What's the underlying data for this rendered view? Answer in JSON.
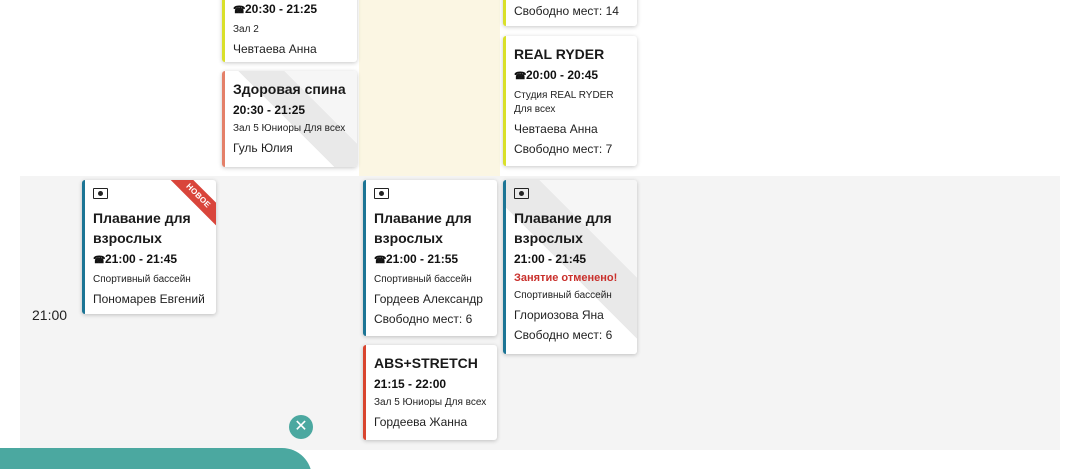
{
  "time_slot": "21:00",
  "cards_top": [
    {
      "time": "20:30 - 21:25",
      "hall": "Зал 2",
      "coach": "Чевтаева Анна"
    },
    {
      "title": "Здоровая спина",
      "time": "20:30 - 21:25",
      "hall": "Зал 5 Юниоры Для всех",
      "coach": "Гуль Юлия"
    },
    {
      "free": "Свободно мест: 14"
    },
    {
      "title": "REAL RYDER",
      "time": "20:00 - 20:45",
      "hall": "Студия REAL RYDER Для всех",
      "coach": "Чевтаева Анна",
      "free": "Свободно мест: 7"
    }
  ],
  "cards_2100": [
    {
      "title": "Плавание для взрослых",
      "time": "21:00 - 21:45",
      "hall": "Спортивный бассейн",
      "coach": "Пономарев Евгений",
      "ribbon": "НОВОЕ"
    },
    {
      "title": "Плавание для взрослых",
      "time": "21:00 - 21:55",
      "hall": "Спортивный бассейн",
      "coach": "Гордеев Александр",
      "free": "Свободно мест: 6"
    },
    {
      "title": "ABS+STRETCH",
      "time": "21:15 - 22:00",
      "hall": "Зал 5 Юниоры Для всех",
      "coach": "Гордеева Жанна"
    },
    {
      "title": "Плавание для взрослых",
      "time": "21:00 - 21:45",
      "cancel": "Занятие отменено!",
      "hall": "Спортивный бассейн",
      "coach": "Глориозова Яна",
      "free": "Свободно мест: 6"
    }
  ],
  "icons": {
    "phone": "phone-icon",
    "money": "money-icon",
    "close": "close-icon"
  },
  "colors": {
    "accent_teal": "#4ba8a0",
    "cancel_red": "#c9302c",
    "ribbon_red": "#d9453b"
  },
  "close_glyph": "✕"
}
